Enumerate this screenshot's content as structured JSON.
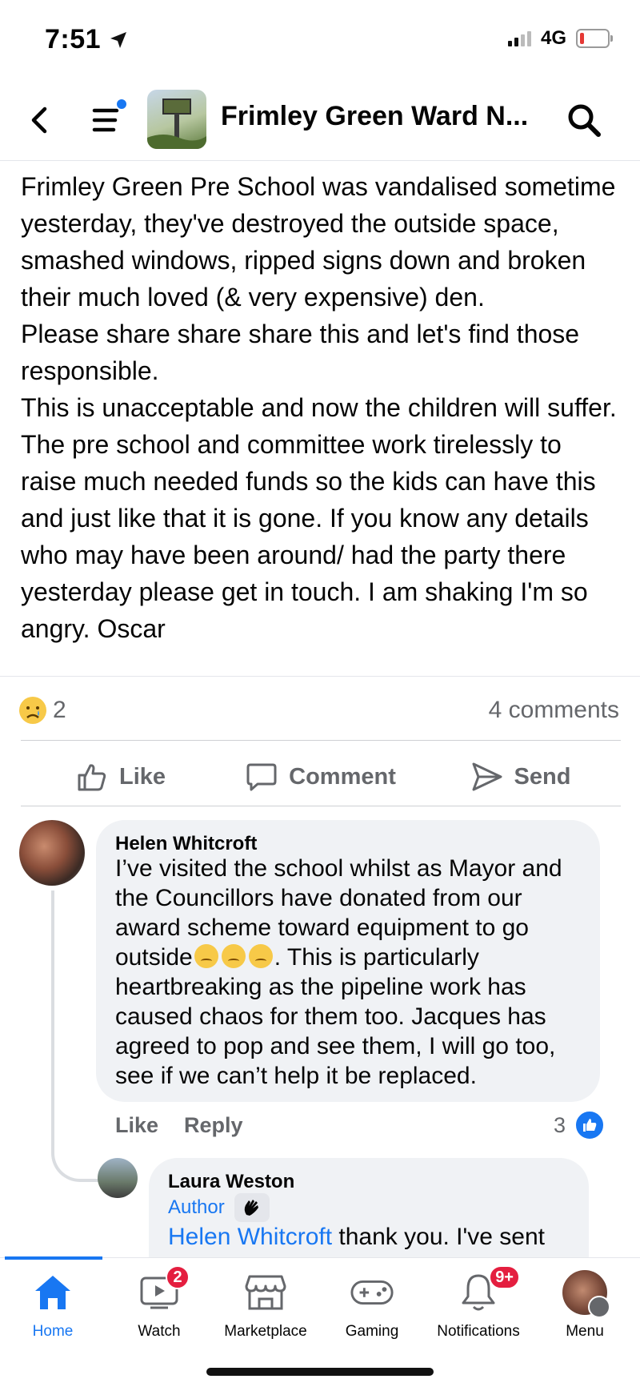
{
  "status_bar": {
    "time": "7:51",
    "network": "4G"
  },
  "header": {
    "title": "Frimley Green Ward N..."
  },
  "post": {
    "paragraphs": [
      "Frimley Green Pre School was vandalised sometime yesterday, they've destroyed the outside space, smashed windows, ripped signs down and broken their much loved (& very expensive) den.",
      "Please share share share this and let's find those responsible.",
      "This is unacceptable and now the children will suffer. The pre school and committee work tirelessly to raise much needed funds so the kids can have this and just like that it is gone. If you know any details who may have been around/ had the party there yesterday please get in touch. I am shaking I'm so angry. Oscar"
    ],
    "reaction_count": "2",
    "comments_count": "4 comments"
  },
  "actions": {
    "like": "Like",
    "comment": "Comment",
    "send": "Send"
  },
  "comments": [
    {
      "author": "Helen Whitcroft",
      "text_part1": "I’ve visited the school whilst as Mayor and the Councillors have donated from our award scheme toward equipment to go outside",
      "text_part2": ". This is particularly heartbreaking as the pipeline work has caused chaos for them too. Jacques has agreed to pop and see them, I will go too, see if we can’t help it be replaced.",
      "like_label": "Like",
      "reply_label": "Reply",
      "like_count": "3"
    },
    {
      "author": "Laura Weston",
      "badge": "Author",
      "mention": "Helen Whitcroft",
      "text": " thank you. I've sent"
    }
  ],
  "tabs": [
    {
      "label": "Home",
      "icon": "home-icon",
      "active": true
    },
    {
      "label": "Watch",
      "icon": "watch-icon",
      "badge": "2"
    },
    {
      "label": "Marketplace",
      "icon": "marketplace-icon"
    },
    {
      "label": "Gaming",
      "icon": "gaming-icon"
    },
    {
      "label": "Notifications",
      "icon": "bell-icon",
      "badge": "9+"
    },
    {
      "label": "Menu",
      "icon": "profile-avatar"
    }
  ],
  "colors": {
    "accent": "#1877f2",
    "badge": "#e41e3f",
    "secondary_text": "#65676b",
    "bubble": "#f0f2f5"
  }
}
